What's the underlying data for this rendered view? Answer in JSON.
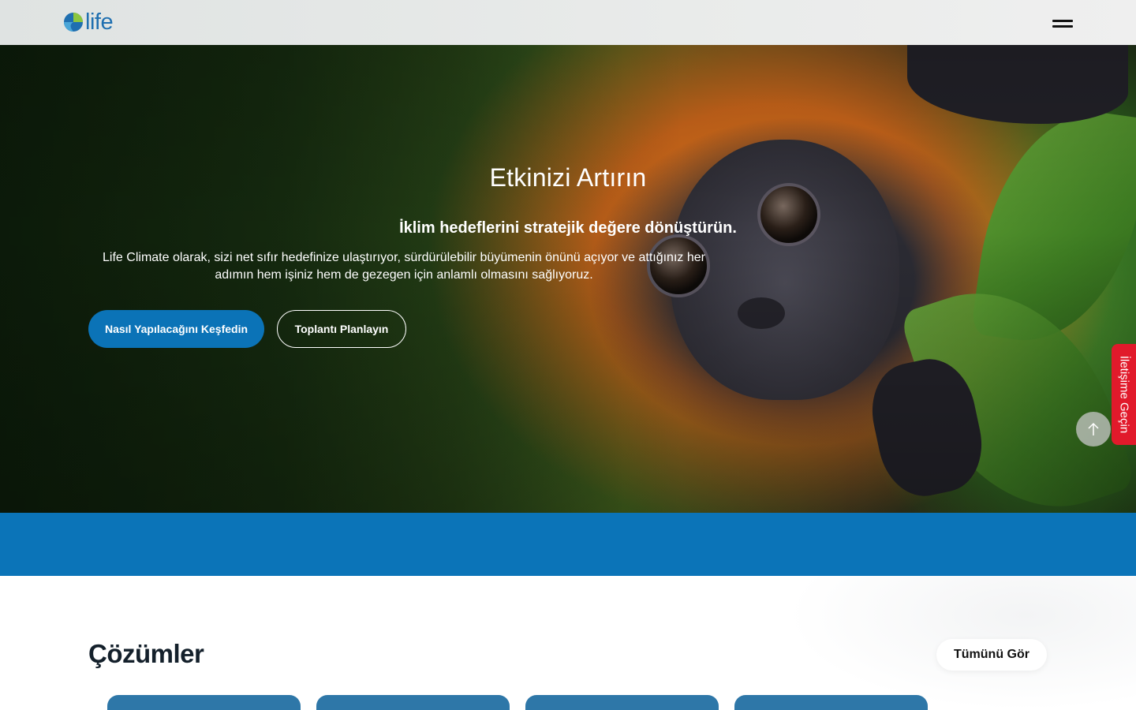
{
  "header": {
    "logo_text": "life",
    "menu_icon": "hamburger-menu-icon"
  },
  "hero": {
    "title": "Etkinizi Artırın",
    "subtitle": "İklim hedeflerini stratejik değere dönüştürün.",
    "description": "Life Climate olarak, sizi net sıfır hedefinize ulaştırıyor, sürdürülebilir büyümenin önünü açıyor ve attığınız her adımın hem işiniz hem de gezegen için anlamlı olmasını sağlıyoruz.",
    "primary_button": "Nasıl Yapılacağını Keşfedin",
    "secondary_button": "Toplantı Planlayın"
  },
  "floating": {
    "contact_tab": "İletişime Geçin",
    "scroll_top_icon": "arrow-up-icon"
  },
  "solutions": {
    "title": "Çözümler",
    "see_all": "Tümünü Gör"
  },
  "colors": {
    "accent": "#0b73b7",
    "band": "#0b74b8",
    "contact": "#e11a2b",
    "card": "#2e77a8"
  }
}
